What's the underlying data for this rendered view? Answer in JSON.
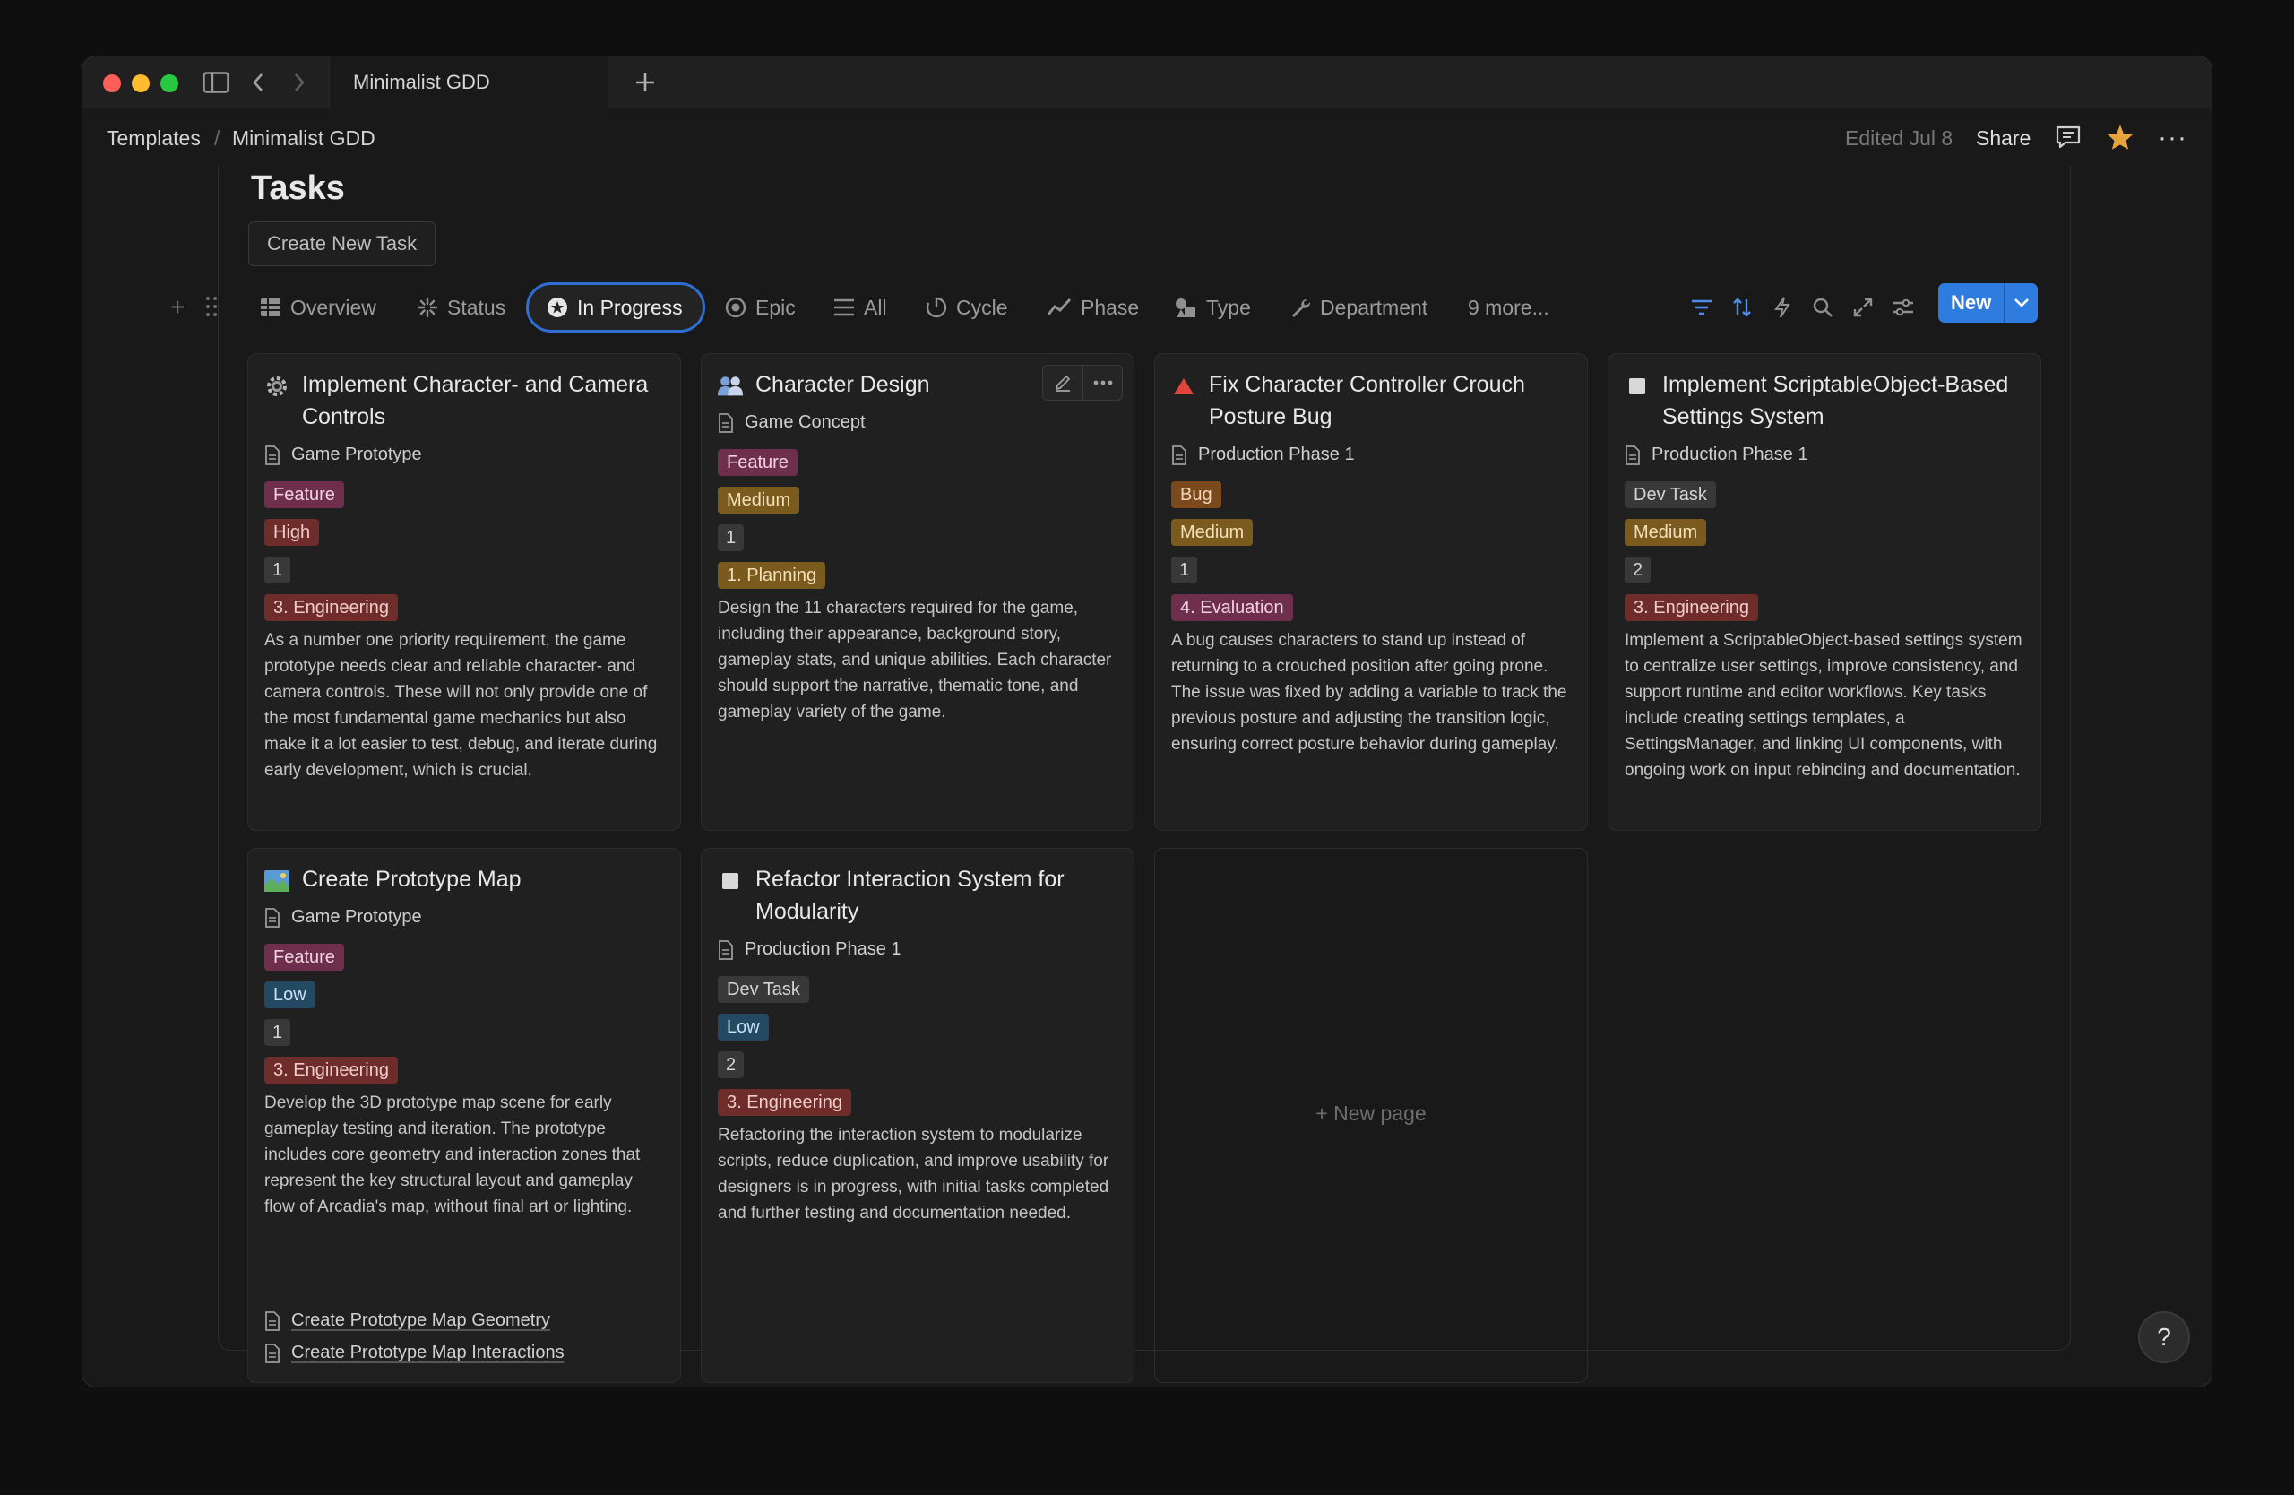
{
  "window": {
    "tab_title": "Minimalist GDD"
  },
  "breadcrumb": {
    "items": [
      "Templates",
      "Minimalist GDD"
    ],
    "separator": "/"
  },
  "header": {
    "edited": "Edited Jul 8",
    "share": "Share"
  },
  "page": {
    "title": "Tasks",
    "create_button": "Create New Task"
  },
  "views": [
    {
      "label": "Overview",
      "icon": "table-icon"
    },
    {
      "label": "Status",
      "icon": "sparkle-icon"
    },
    {
      "label": "In Progress",
      "icon": "star-circle-icon",
      "active": true
    },
    {
      "label": "Epic",
      "icon": "target-icon"
    },
    {
      "label": "All",
      "icon": "list-icon"
    },
    {
      "label": "Cycle",
      "icon": "cycle-icon"
    },
    {
      "label": "Phase",
      "icon": "chart-icon"
    },
    {
      "label": "Type",
      "icon": "shapes-icon"
    },
    {
      "label": "Department",
      "icon": "wrench-icon"
    },
    {
      "label": "9 more..."
    }
  ],
  "toolbar": {
    "new_label": "New"
  },
  "cards": [
    {
      "title": "Implement Character- and Camera Controls",
      "icon": "gear-icon",
      "parent": "Game Prototype",
      "tags": [
        {
          "text": "Feature",
          "kind": "feature"
        },
        {
          "text": "High",
          "kind": "high"
        },
        {
          "text": "1",
          "kind": "num"
        },
        {
          "text": "3. Engineering",
          "kind": "eng"
        }
      ],
      "description": "As a number one priority requirement, the game prototype needs clear and reliable character- and camera controls. These will not only provide one of the most fundamental game mechanics but also make it a lot easier to test, debug, and iterate during early development, which is crucial."
    },
    {
      "title": "Character Design",
      "icon": "people-icon",
      "parent": "Game Concept",
      "tags": [
        {
          "text": "Feature",
          "kind": "feature"
        },
        {
          "text": "Medium",
          "kind": "medium"
        },
        {
          "text": "1",
          "kind": "num"
        },
        {
          "text": "1. Planning",
          "kind": "plan"
        }
      ],
      "description": "Design the 11 characters required for the game, including their appearance, background story, gameplay stats, and unique abilities. Each character should support the narrative, thematic tone, and gameplay variety of the game."
    },
    {
      "title": "Fix Character Controller Crouch Posture Bug",
      "icon": "warning-triangle-icon",
      "parent": "Production Phase 1",
      "tags": [
        {
          "text": "Bug",
          "kind": "bug"
        },
        {
          "text": "Medium",
          "kind": "medium"
        },
        {
          "text": "1",
          "kind": "num"
        },
        {
          "text": "4. Evaluation",
          "kind": "eval"
        }
      ],
      "description": "A bug causes characters to stand up instead of returning to a crouched position after going prone. The issue was fixed by adding a variable to track the previous posture and adjusting the transition logic, ensuring correct posture behavior during gameplay."
    },
    {
      "title": "Implement ScriptableObject-Based Settings System",
      "icon": "square-icon",
      "parent": "Production Phase 1",
      "tags": [
        {
          "text": "Dev Task",
          "kind": "devtask"
        },
        {
          "text": "Medium",
          "kind": "medium"
        },
        {
          "text": "2",
          "kind": "num"
        },
        {
          "text": "3. Engineering",
          "kind": "eng"
        }
      ],
      "description": "Implement a ScriptableObject-based settings system to centralize user settings, improve consistency, and support runtime and editor workflows. Key tasks include creating settings templates, a SettingsManager, and linking UI components, with ongoing work on input rebinding and documentation."
    },
    {
      "title": "Create Prototype Map",
      "icon": "map-icon",
      "parent": "Game Prototype",
      "tags": [
        {
          "text": "Feature",
          "kind": "feature"
        },
        {
          "text": "Low",
          "kind": "low"
        },
        {
          "text": "1",
          "kind": "num"
        },
        {
          "text": "3. Engineering",
          "kind": "eng"
        }
      ],
      "description": "Develop the 3D prototype map scene for early gameplay testing and iteration. The prototype includes core geometry and interaction zones that represent the key structural layout and gameplay flow of Arcadia's map, without final art or lighting.",
      "subitems": [
        "Create Prototype Map Geometry",
        "Create Prototype Map Interactions"
      ]
    },
    {
      "title": "Refactor Interaction System for Modularity",
      "icon": "square-icon",
      "parent": "Production Phase 1",
      "tags": [
        {
          "text": "Dev Task",
          "kind": "devtask"
        },
        {
          "text": "Low",
          "kind": "low"
        },
        {
          "text": "2",
          "kind": "num"
        },
        {
          "text": "3. Engineering",
          "kind": "eng"
        }
      ],
      "description": "Refactoring the interaction system to modularize scripts, reduce duplication, and improve usability for designers is in progress, with initial tasks completed and further testing and documentation needed."
    }
  ],
  "new_page": "+ New page",
  "help": "?"
}
